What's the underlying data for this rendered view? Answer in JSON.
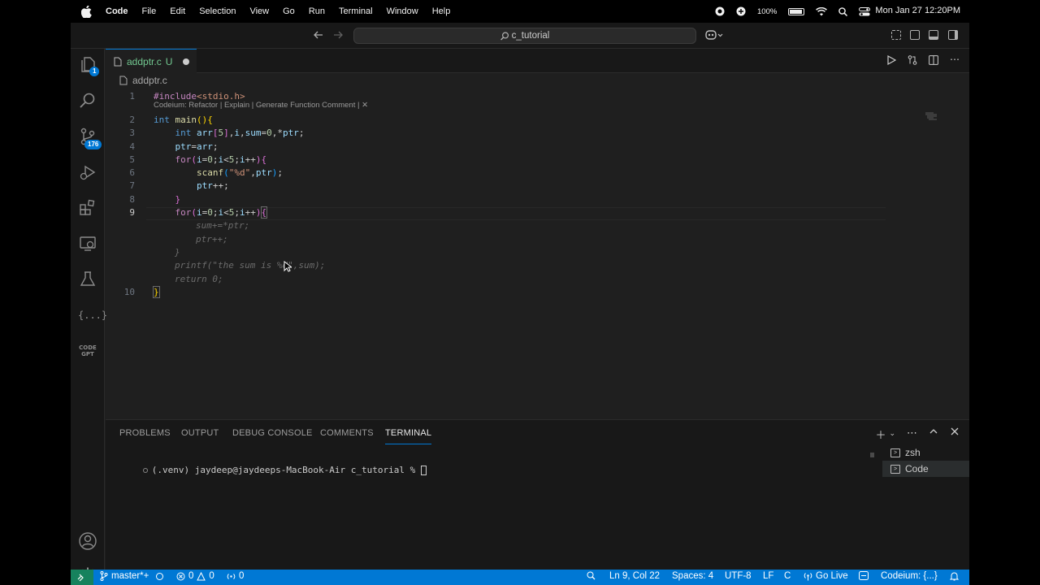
{
  "menubar": {
    "app_name": "Code",
    "items": [
      "File",
      "Edit",
      "Selection",
      "View",
      "Go",
      "Run",
      "Terminal",
      "Window",
      "Help"
    ],
    "battery": "100%",
    "clock": "Mon Jan 27  12:20PM"
  },
  "titlebar": {
    "search_text": "c_tutorial"
  },
  "activity": {
    "explorer_badge": "1",
    "scm_badge": "176"
  },
  "tab": {
    "filename": "addptr.c",
    "status": "U"
  },
  "breadcrumb": {
    "file": "addptr.c"
  },
  "editor": {
    "codelens": "Codeium: Refactor | Explain | Generate Function Comment | ✕",
    "line_numbers": [
      "1",
      "2",
      "3",
      "4",
      "5",
      "6",
      "7",
      "8",
      "9",
      "10"
    ],
    "active_line": "9",
    "ghost_lines": [
      "sum+=*ptr;",
      "ptr++;",
      "}",
      "printf(\"the sum is %d\",sum);",
      "return 0;"
    ]
  },
  "panel": {
    "tabs": [
      "PROBLEMS",
      "OUTPUT",
      "DEBUG CONSOLE",
      "COMMENTS",
      "TERMINAL"
    ],
    "active_tab": "TERMINAL",
    "prompt": "(.venv) jaydeep@jaydeeps-MacBook-Air c_tutorial % ",
    "terminals": [
      "zsh",
      "Code"
    ]
  },
  "statusbar": {
    "branch": "master*+",
    "errors": "0",
    "warnings": "0",
    "ports": "0",
    "position": "Ln 9, Col 22",
    "spaces": "Spaces: 4",
    "encoding": "UTF-8",
    "eol": "LF",
    "language": "C",
    "golive": "Go Live",
    "codeium": "Codeium: {...}"
  },
  "colors": {
    "accent": "#0078d4",
    "untracked": "#73c991",
    "remote": "#16825d"
  }
}
